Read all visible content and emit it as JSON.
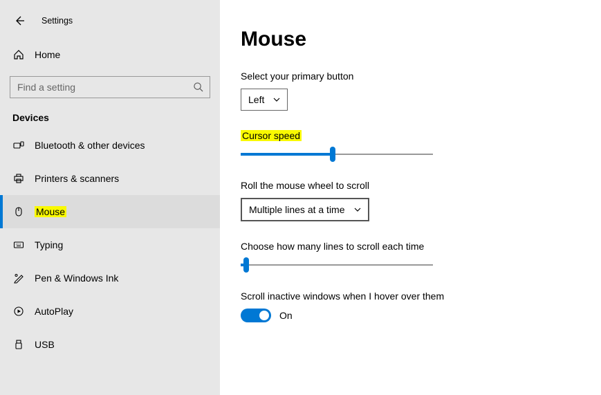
{
  "topbar": {
    "title": "Settings"
  },
  "home": {
    "label": "Home"
  },
  "search": {
    "placeholder": "Find a setting"
  },
  "section_title": "Devices",
  "nav": [
    {
      "label": "Bluetooth & other devices"
    },
    {
      "label": "Printers & scanners"
    },
    {
      "label": "Mouse"
    },
    {
      "label": "Typing"
    },
    {
      "label": "Pen & Windows Ink"
    },
    {
      "label": "AutoPlay"
    },
    {
      "label": "USB"
    }
  ],
  "page": {
    "title": "Mouse",
    "primary_button": {
      "label": "Select your primary button",
      "value": "Left"
    },
    "cursor_speed": {
      "label": "Cursor speed",
      "value_pct": 48
    },
    "wheel_mode": {
      "label": "Roll the mouse wheel to scroll",
      "value": "Multiple lines at a time"
    },
    "lines_per_scroll": {
      "label": "Choose how many lines to scroll each time",
      "value_pct": 3
    },
    "inactive_scroll": {
      "label": "Scroll inactive windows when I hover over them",
      "value": true,
      "value_label": "On"
    }
  }
}
